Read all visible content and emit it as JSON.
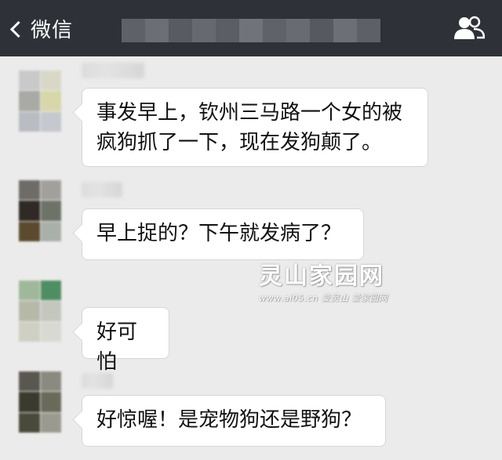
{
  "topbar": {
    "back_label": "微信",
    "title_blurred": true,
    "group_icon": "contacts-icon"
  },
  "messages": [
    {
      "text": "事发早上，钦州三马路一个女的被\n疯狗抓了一下，现在发狗颠了。"
    },
    {
      "text": "早上捉的？下午就发病了？"
    },
    {
      "text": "好可怕"
    },
    {
      "text": "好惊喔！是宠物狗还是野狗？"
    }
  ],
  "watermark": {
    "title": "灵山家园网",
    "subtitle": "www.ai05.cn 爱灵山 爱家园网"
  },
  "colors": {
    "topbar": "#2e3238",
    "chat_background": "#ebebeb",
    "bubble": "#ffffff",
    "bubble_border": "#d6d6d6",
    "text": "#111111"
  }
}
